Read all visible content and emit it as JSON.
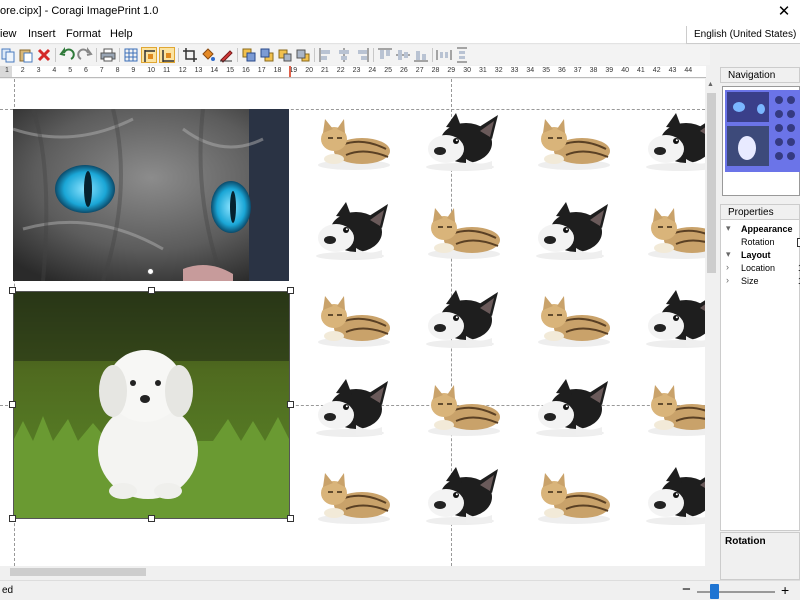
{
  "window": {
    "title": "ore.cipx] - Coragi ImagePrint 1.0",
    "close_glyph": "✕"
  },
  "menu": {
    "items": [
      "iew",
      "Insert",
      "Format",
      "Help"
    ]
  },
  "language": "English (United States)",
  "toolbar": {
    "icons": [
      "copy-icon",
      "paste-icon",
      "delete-icon",
      "undo-icon",
      "redo-icon",
      "print-icon",
      "grid-icon",
      "align-top-left-icon",
      "align-bottom-icon",
      "crop-icon",
      "fill-icon",
      "pen-icon",
      "bring-front-icon",
      "send-back-icon",
      "move-up-icon",
      "move-down-icon",
      "align-left-icon",
      "align-center-icon",
      "align-right-icon",
      "align-top-icon",
      "align-middle-icon",
      "align-bottom-edge-icon",
      "distribute-h-icon",
      "distribute-v-icon"
    ]
  },
  "ruler": {
    "ticks": [
      "1",
      "2",
      "3",
      "4",
      "5",
      "6",
      "7",
      "8",
      "9",
      "10",
      "11",
      "12",
      "13",
      "14",
      "15",
      "16",
      "17",
      "18",
      "19",
      "20",
      "21",
      "22",
      "23",
      "24",
      "25",
      "26",
      "27",
      "28",
      "29",
      "30",
      "31",
      "32",
      "33",
      "34",
      "35",
      "36",
      "37",
      "38",
      "39",
      "40",
      "41",
      "42",
      "43",
      "44"
    ]
  },
  "canvas": {
    "images": [
      {
        "name": "cat-photo",
        "kind": "cat-eyes"
      },
      {
        "name": "dog-photo",
        "kind": "white-dog"
      }
    ],
    "tiles": [
      [
        "cat",
        "dog",
        "cat",
        "dog"
      ],
      [
        "dog",
        "cat",
        "dog",
        "cat"
      ],
      [
        "cat",
        "dog",
        "cat",
        "dog"
      ],
      [
        "dog",
        "cat",
        "dog",
        "cat"
      ],
      [
        "cat",
        "dog",
        "cat",
        "dog"
      ]
    ]
  },
  "panels": {
    "navigation_title": "Navigation",
    "properties_title": "Properties",
    "properties": [
      {
        "type": "category",
        "label": "Appearance",
        "arrow": "▾"
      },
      {
        "type": "item",
        "label": "Rotation",
        "value": ""
      },
      {
        "type": "category",
        "label": "Layout",
        "arrow": "▾"
      },
      {
        "type": "item",
        "label": "Location",
        "value": "1",
        "arrow": "›"
      },
      {
        "type": "item",
        "label": "Size",
        "value": "1",
        "arrow": "›"
      }
    ],
    "description_title": "Rotation"
  },
  "status": {
    "text": "ed",
    "zoom_minus": "−",
    "zoom_plus": "+",
    "zoom_level": 0.22
  },
  "colors": {
    "selection_highlight": "#6b74e8",
    "ruler_marker": "#e0604a",
    "zoom_thumb": "#1e74d2"
  }
}
